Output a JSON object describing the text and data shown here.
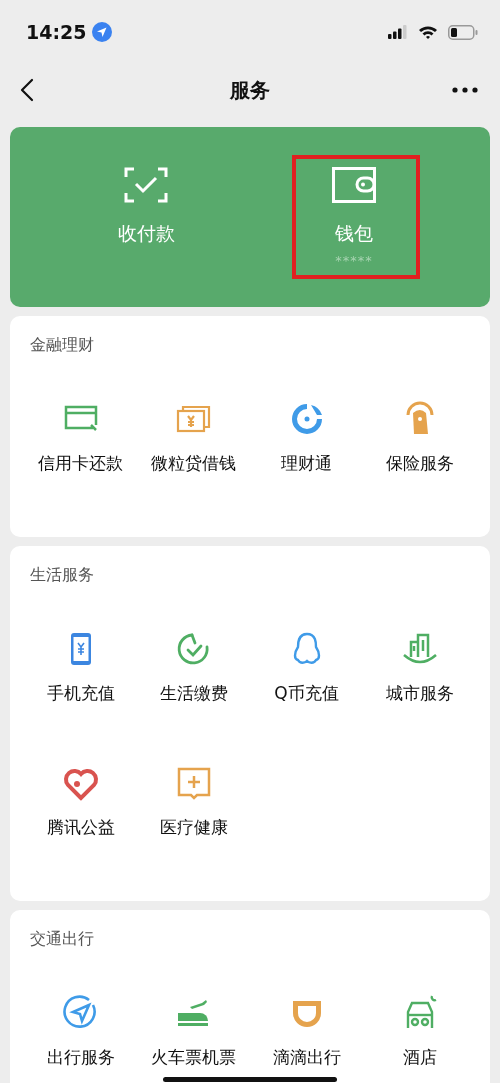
{
  "status_bar": {
    "time": "14:25"
  },
  "nav": {
    "title": "服务"
  },
  "top_card": {
    "tiles": [
      {
        "label": "收付款",
        "highlighted": false
      },
      {
        "label": "钱包",
        "balance": "*****",
        "highlighted": true
      }
    ]
  },
  "sections": [
    {
      "title": "金融理财",
      "items": [
        {
          "label": "信用卡还款"
        },
        {
          "label": "微粒贷借钱"
        },
        {
          "label": "理财通"
        },
        {
          "label": "保险服务"
        }
      ]
    },
    {
      "title": "生活服务",
      "items": [
        {
          "label": "手机充值"
        },
        {
          "label": "生活缴费"
        },
        {
          "label": "Q币充值"
        },
        {
          "label": "城市服务"
        },
        {
          "label": "腾讯公益"
        },
        {
          "label": "医疗健康"
        }
      ]
    },
    {
      "title": "交通出行",
      "items": [
        {
          "label": "出行服务"
        },
        {
          "label": "火车票机票"
        },
        {
          "label": "滴滴出行"
        },
        {
          "label": "酒店"
        }
      ]
    }
  ]
}
